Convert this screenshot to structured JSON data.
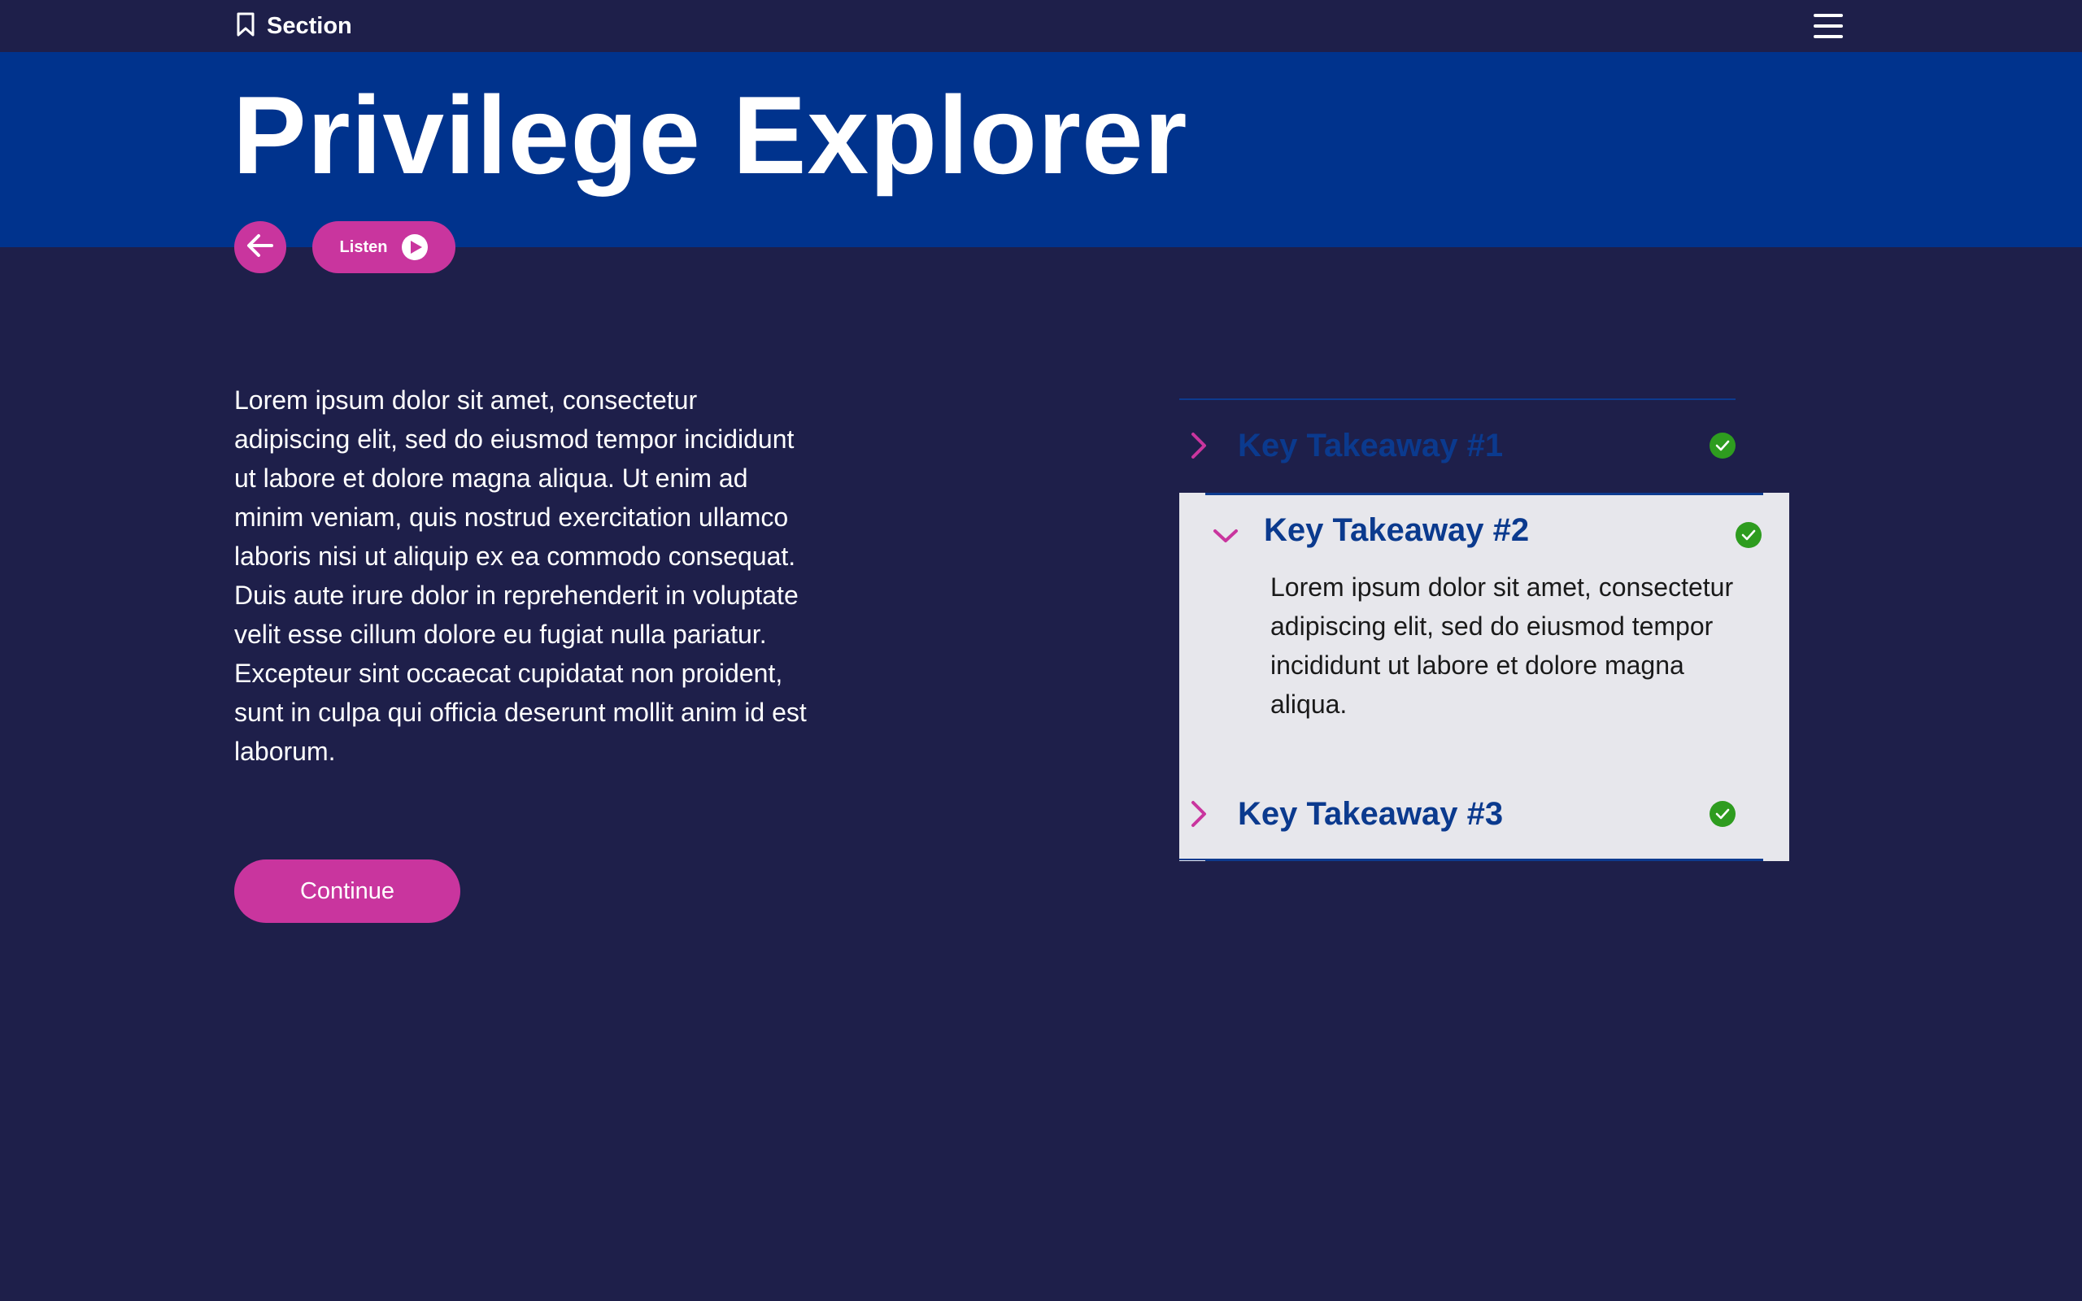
{
  "topbar": {
    "section_label": "Section",
    "section_icon": "bookmark-icon",
    "menu_icon": "hamburger-menu-icon"
  },
  "hero": {
    "title": "Privilege Explorer",
    "back_icon": "arrow-left-icon",
    "listen_label": "Listen",
    "listen_icon": "play-icon"
  },
  "main": {
    "body_text": "Lorem ipsum dolor sit amet, consectetur adipiscing elit, sed do eiusmod tempor incididunt ut labore et dolore magna aliqua. Ut enim ad minim veniam, quis nostrud exercitation ullamco laboris nisi ut aliquip ex ea commodo consequat. Duis aute irure dolor in reprehenderit in voluptate velit esse cillum dolore eu fugiat nulla pariatur. Excepteur sint occaecat cupidatat non proident, sunt in culpa qui officia deserunt mollit anim id est laborum.",
    "continue_label": "Continue"
  },
  "accordion": {
    "items": [
      {
        "title": "Key Takeaway #1",
        "expanded": false,
        "completed": true
      },
      {
        "title": "Key Takeaway #2",
        "expanded": true,
        "completed": true,
        "body": "Lorem ipsum dolor sit amet, consectetur adipiscing elit, sed do eiusmod tempor incididunt ut labore et dolore magna aliqua."
      },
      {
        "title": "Key Takeaway #3",
        "expanded": false,
        "completed": true
      }
    ]
  },
  "colors": {
    "background": "#1e1f4a",
    "hero": "#00338d",
    "accent": "#c9359e",
    "heading_blue": "#0b3a8e",
    "panel": "#e7e7ec",
    "check_green": "#2e9c1f"
  }
}
